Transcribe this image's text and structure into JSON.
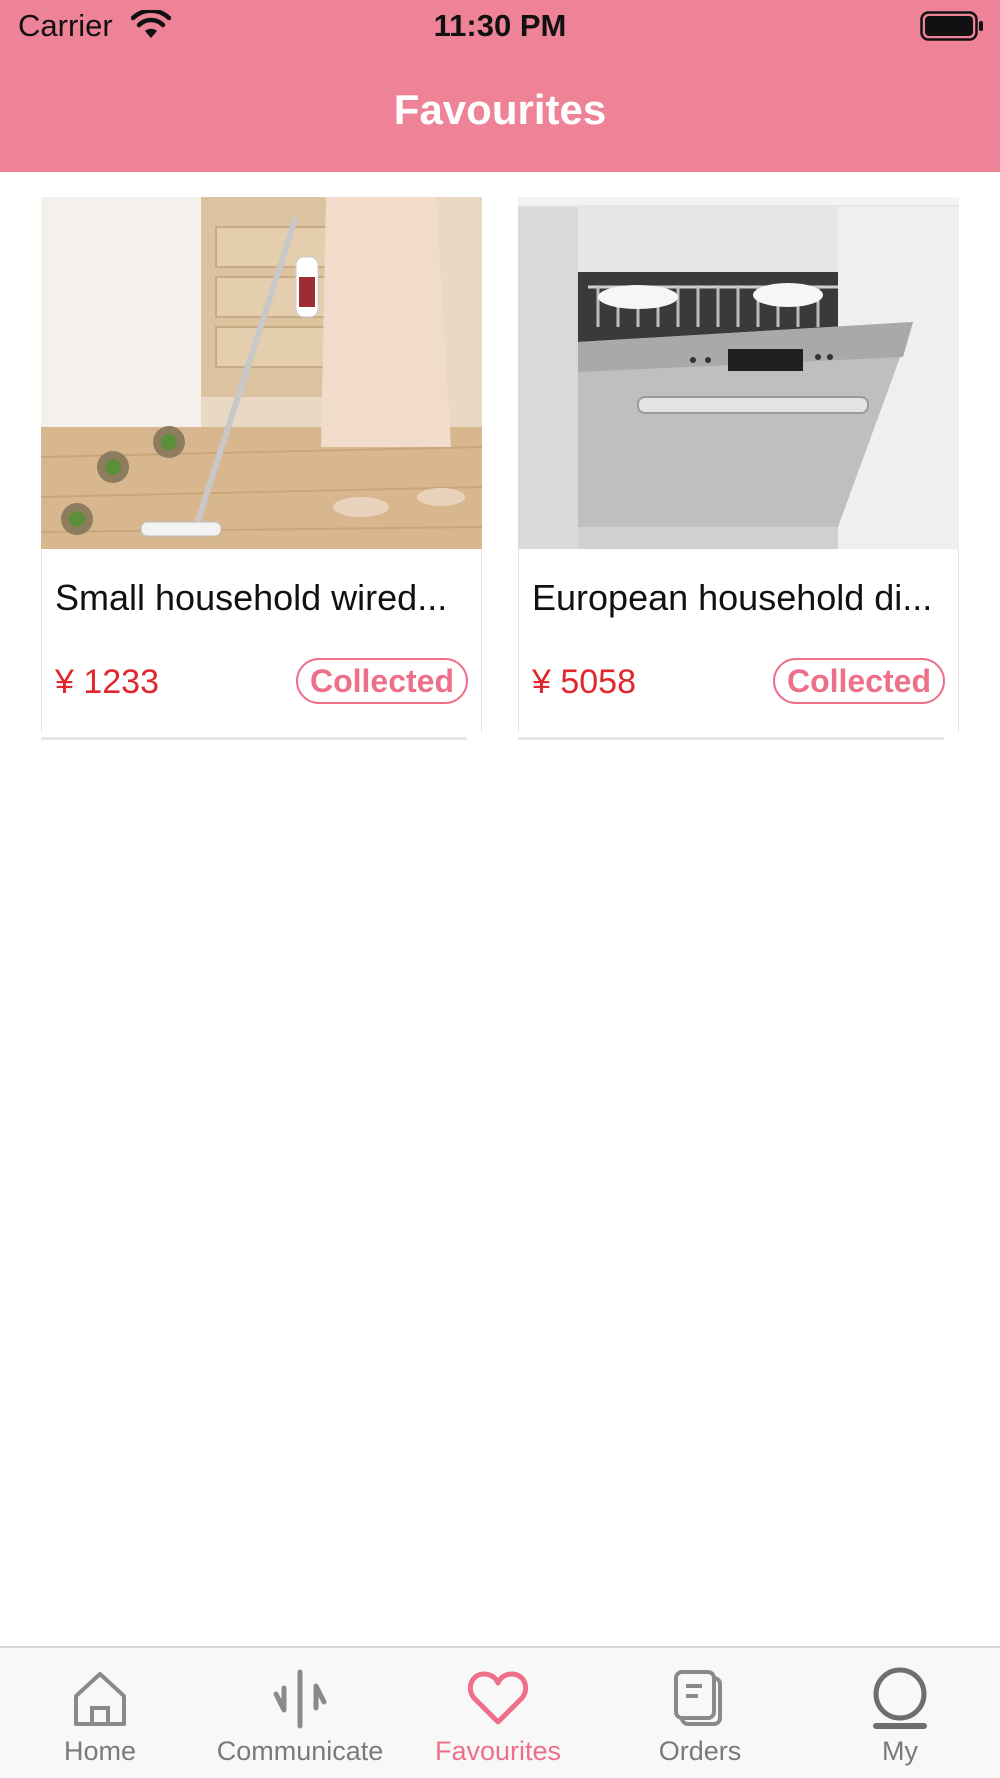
{
  "status_bar": {
    "carrier": "Carrier",
    "time": "11:30 PM",
    "wifi_icon": "wifi-icon",
    "battery_icon": "battery-icon"
  },
  "header": {
    "title": "Favourites",
    "background_color": "#ee8397"
  },
  "favourites": [
    {
      "title": "Small household wired...",
      "price": "¥ 1233",
      "status_label": "Collected",
      "image": "vacuum-cleaner-image"
    },
    {
      "title": "European household di...",
      "price": "¥ 5058",
      "status_label": "Collected",
      "image": "dishwasher-image"
    }
  ],
  "tab_bar": {
    "tabs": [
      {
        "label": "Home",
        "icon": "home-icon",
        "active": false
      },
      {
        "label": "Communicate",
        "icon": "communicate-icon",
        "active": false
      },
      {
        "label": "Favourites",
        "icon": "heart-icon",
        "active": true
      },
      {
        "label": "Orders",
        "icon": "orders-icon",
        "active": false
      },
      {
        "label": "My",
        "icon": "profile-icon",
        "active": false
      }
    ]
  },
  "colors": {
    "accent": "#ee6f89",
    "price": "#e1262d",
    "tab_inactive": "#7a7a7a"
  }
}
